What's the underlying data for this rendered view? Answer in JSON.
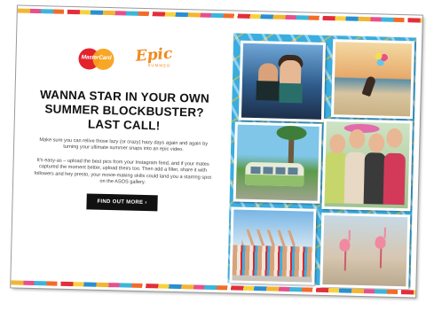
{
  "flyer": {
    "logos": {
      "mastercard": "MasterCard",
      "epic_word": "Epic",
      "epic_sub": "SUMMER"
    },
    "headline": [
      "WANNA STAR IN YOUR OWN",
      "SUMMER BLOCKBUSTER?",
      "LAST CALL!"
    ],
    "paragraph_1": "Make sure you can relive those lazy (or crazy) hazy days again and again by turning your ultimate summer snaps into an epic video.",
    "paragraph_2": "It's easy-as – upload the best pics from your Instagram feed, and if your mates captured the moment better, upload theirs too. Then add a filter, share it with followers and hey presto, your movie-making skills could land you a starring spot on the ASOS gallery.",
    "cta_label": "FIND OUT MORE ›"
  },
  "colors": {
    "accent_orange": "#f08a1e",
    "collage_blue": "#3aaee0",
    "cta_background": "#111111"
  }
}
